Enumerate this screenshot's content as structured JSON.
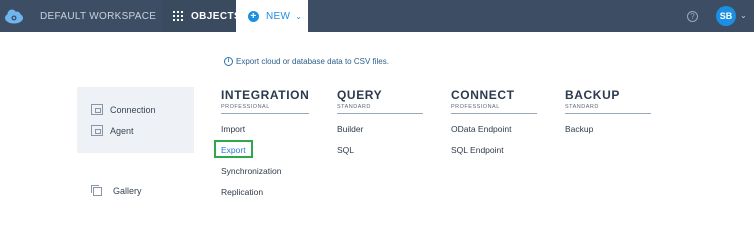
{
  "topbar": {
    "workspace_label": "DEFAULT WORKSPACE",
    "objects_label": "OBJECTS",
    "new_label": "NEW",
    "help_label": "?",
    "avatar_initials": "SB"
  },
  "info": {
    "text": "Export cloud or database data to CSV files."
  },
  "side": {
    "items": [
      {
        "label": "Connection",
        "icon": "connection-icon"
      },
      {
        "label": "Agent",
        "icon": "agent-icon"
      }
    ],
    "gallery_label": "Gallery"
  },
  "columns": [
    {
      "title": "INTEGRATION",
      "subtitle": "PROFESSIONAL",
      "items": [
        "Import",
        "Export",
        "Synchronization",
        "Replication"
      ]
    },
    {
      "title": "QUERY",
      "subtitle": "STANDARD",
      "items": [
        "Builder",
        "SQL"
      ]
    },
    {
      "title": "CONNECT",
      "subtitle": "PROFESSIONAL",
      "items": [
        "OData Endpoint",
        "SQL Endpoint"
      ]
    },
    {
      "title": "BACKUP",
      "subtitle": "STANDARD",
      "items": [
        "Backup"
      ]
    }
  ],
  "colors": {
    "topbar": "#3d4e64",
    "accent": "#1a8fe3",
    "highlight": "#2ea84a"
  }
}
